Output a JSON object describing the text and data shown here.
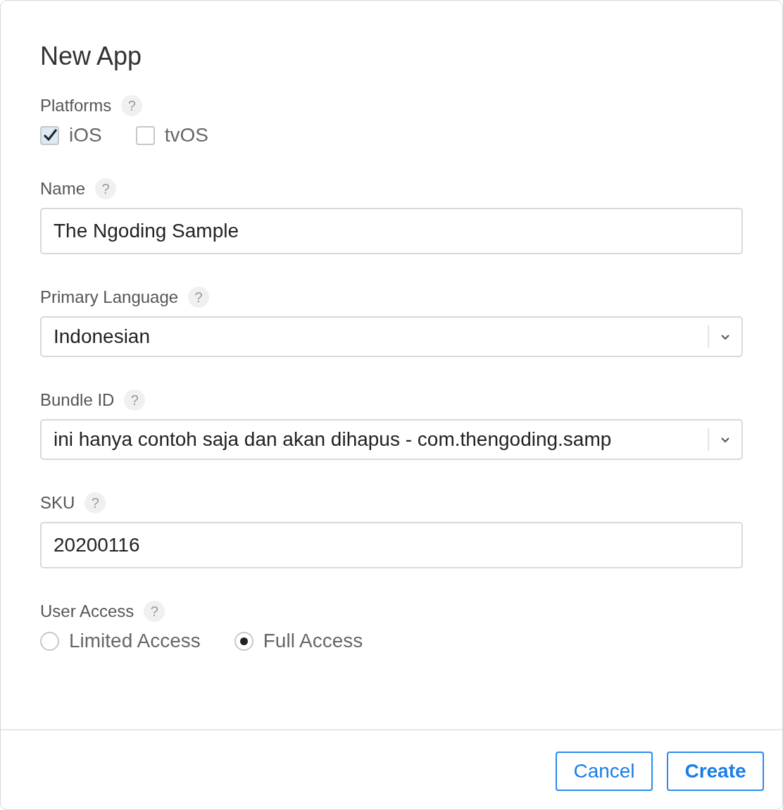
{
  "dialog": {
    "title": "New App",
    "fields": [
      {
        "kind": "checkboxes",
        "label": "Platforms",
        "help": "?",
        "options": [
          {
            "label": "iOS",
            "checked": true
          },
          {
            "label": "tvOS",
            "checked": false
          }
        ]
      },
      {
        "kind": "text",
        "label": "Name",
        "help": "?",
        "value": "The Ngoding Sample"
      },
      {
        "kind": "select",
        "label": "Primary Language",
        "help": "?",
        "value": "Indonesian"
      },
      {
        "kind": "select",
        "label": "Bundle ID",
        "help": "?",
        "value": "ini hanya contoh saja dan akan dihapus - com.thengoding.samp"
      },
      {
        "kind": "text",
        "label": "SKU",
        "help": "?",
        "value": "20200116"
      },
      {
        "kind": "radios",
        "label": "User Access",
        "help": "?",
        "options": [
          {
            "label": "Limited Access",
            "selected": false
          },
          {
            "label": "Full Access",
            "selected": true
          }
        ]
      }
    ],
    "buttons": [
      {
        "label": "Cancel",
        "primary": false
      },
      {
        "label": "Create",
        "primary": true
      }
    ]
  }
}
